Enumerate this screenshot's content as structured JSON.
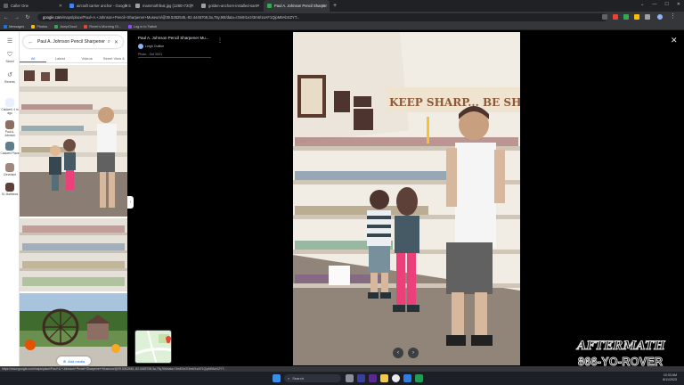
{
  "browser": {
    "tabs": [
      {
        "label": "Caller One",
        "color": "#5f6368"
      },
      {
        "label": "aircraft carrier anchor - Google S",
        "color": "#4285f4"
      },
      {
        "label": "mammothfeat.jpg (1280×720)",
        "color": "#9aa0a6"
      },
      {
        "label": "golden-anchors-installed-sam",
        "color": "#9aa0a6"
      },
      {
        "label": "Paul A. Johnson Pencil Sharper",
        "color": "#34a853"
      }
    ],
    "url_host": "google.com",
    "url_rest": "/maps/place/Paul+A.+Johnson+Pencil+Sharpener+Museum/@39.5362545,-82.4445708,3a,75y,90t/data=!3m8!1e2!3m6!1sAF1QipM9AbXZYT..."
  },
  "bookmarks": [
    {
      "label": "Messages",
      "color": "#1a73e8"
    },
    {
      "label": "Photos",
      "color": "#fbbc04"
    },
    {
      "label": "JumpCloud",
      "color": "#34a853"
    },
    {
      "label": "Rover's Morning Gl...",
      "color": "#ea4335"
    },
    {
      "label": "Log in to Twitch",
      "color": "#9146ff"
    }
  ],
  "rail": {
    "menu_icon": "menu-icon",
    "items": [
      {
        "label": "Saved",
        "icon": "bookmark-icon"
      },
      {
        "label": "Recents",
        "icon": "history-icon"
      },
      {
        "label": "Caldwell, 4 m ago",
        "icon": "location-icon"
      },
      {
        "label": "Paul A. Johnson",
        "icon": "place-thumb"
      },
      {
        "label": "Caldwell Plaza",
        "icon": "place-thumb"
      },
      {
        "label": "Cleveland",
        "icon": "place-thumb"
      },
      {
        "label": "St. Matthews",
        "icon": "place-thumb"
      }
    ]
  },
  "panel": {
    "search_query": "Paul A. Johnson Pencil Sharpener",
    "filters": [
      "All",
      "Latest",
      "Videos",
      "Street View & 360°"
    ],
    "add_media": "Add media"
  },
  "viewer": {
    "title": "Paul A. Johnson Pencil Sharpener Mu...",
    "author": "Leigh Outline",
    "date": "Photo - Oct 2021",
    "watermark_line1": "AFTERMATH",
    "watermark_line2": "866-YO-ROVER"
  },
  "status_url": "https://www.google.com/maps/place/Paul+A.+Johnson+Pencil+Sharpener+Museum/@39.5362545,-82.4445708,3a,75y,90t/data=!3m8!1e2!3m6!1sAF1QipM9AbXZYT...",
  "taskbar": {
    "search_label": "Search",
    "time": "10:33 AM",
    "date": "8/11/2023"
  },
  "colors": {
    "accent": "#1a73e8",
    "chrome_dark": "#202124"
  }
}
